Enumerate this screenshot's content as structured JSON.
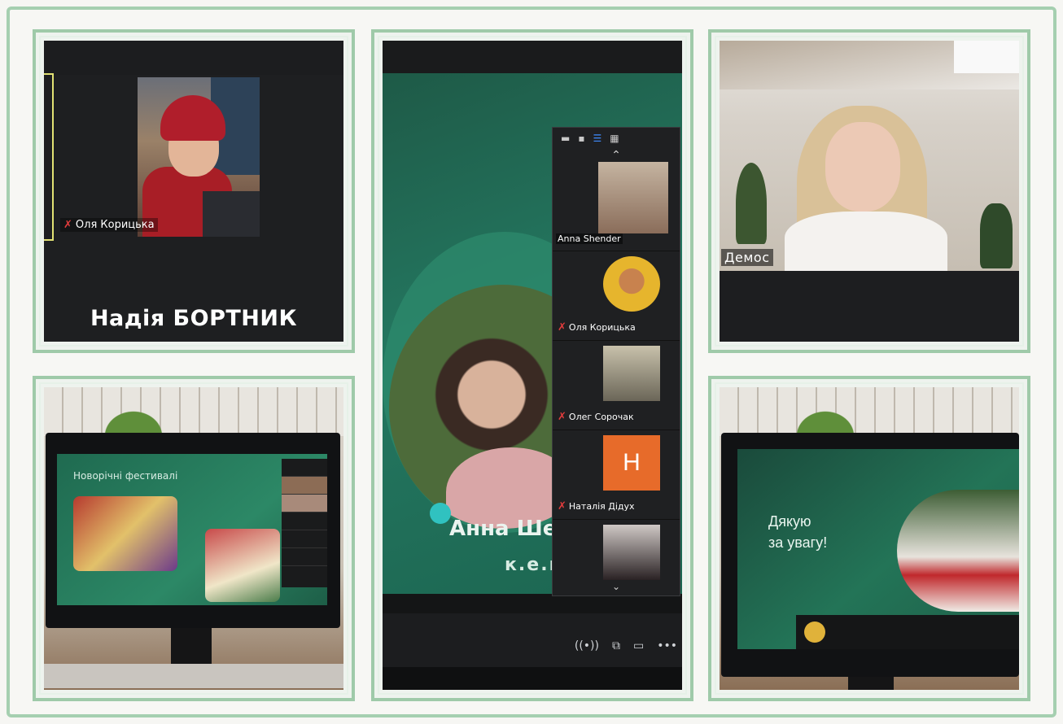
{
  "tile1": {
    "participant_name": "Оля Корицька",
    "caption": "Надія БОРТНИК"
  },
  "tile2": {
    "slide_title": "Анна Ше",
    "slide_subtitle": "к.е.н",
    "panel": {
      "participants": [
        {
          "name": "Anna Shender",
          "muted": false
        },
        {
          "name": "Оля Корицька",
          "muted": true
        },
        {
          "name": "Олег Сорочак",
          "muted": true
        },
        {
          "name": "Наталія Дідух",
          "muted": true,
          "initial": "Н"
        },
        {
          "name": "",
          "muted": false
        }
      ]
    }
  },
  "tile3": {
    "participant_name": "Демос"
  },
  "tile4": {
    "slide_title": "Новорічні фестивалі"
  },
  "tile6": {
    "slide_text_line1": "Дякую",
    "slide_text_line2": "за увагу!"
  },
  "icons": {
    "mic_off": "✗"
  },
  "colors": {
    "frame_green": "#9fcaa9",
    "slide_green": "#247760",
    "accent_teal": "#30c2c0",
    "mic_red": "#e23c3c"
  }
}
